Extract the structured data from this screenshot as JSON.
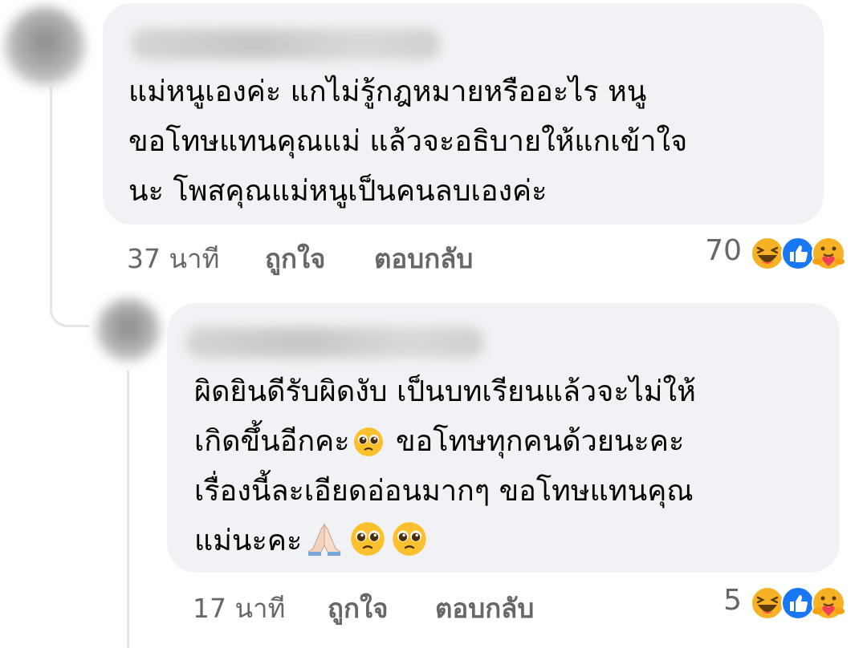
{
  "comments": [
    {
      "lines": [
        "แม่หนูเองค่ะ แกไม่รู้กฎหมายหรืออะไร หนู",
        "ขอโทษแทนคุณแม่ แล้วจะอธิบายให้แกเข้าใจ",
        "นะ โพสคุณแม่หนูเป็นคนลบเองค่ะ"
      ],
      "time": "37 นาที",
      "like_label": "ถูกใจ",
      "reply_label": "ตอบกลับ",
      "reaction_count": "70",
      "reactions": [
        "haha-icon",
        "like-icon",
        "care-icon"
      ]
    },
    {
      "lines": [
        "ผิดยินดีรับผิดงับ เป็นบทเรียนแล้วจะไม่ให้",
        "เกิดขึ้นอีกคะ",
        "ขอโทษทุกคนด้วยนะคะ",
        "เรื่องนี้ละเอียดอ่อนมากๆ ขอโทษแทนคุณ",
        "แม่นะคะ"
      ],
      "inline_emojis": [
        "pleading-face-icon",
        "folded-hands-icon",
        "pleading-face-icon",
        "pleading-face-icon"
      ],
      "time": "17 นาที",
      "like_label": "ถูกใจ",
      "reply_label": "ตอบกลับ",
      "reaction_count": "5",
      "reactions": [
        "haha-icon",
        "like-icon",
        "care-icon"
      ]
    }
  ],
  "colors": {
    "bubble": "#f0f2f5",
    "text": "#050505",
    "meta": "#65676b",
    "like_blue": "#1877f2",
    "reaction_yellow": "#f7b125"
  }
}
